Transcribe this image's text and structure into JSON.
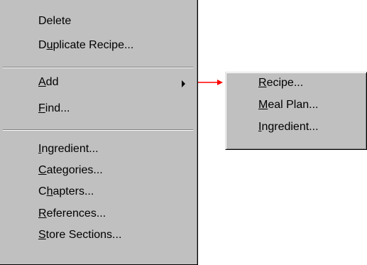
{
  "menu": {
    "items": [
      {
        "pre": "",
        "ul": "",
        "post": "Delete"
      },
      {
        "pre": "D",
        "ul": "u",
        "post": "plicate Recipe..."
      },
      {
        "pre": "",
        "ul": "A",
        "post": "dd"
      },
      {
        "pre": "",
        "ul": "F",
        "post": "ind..."
      },
      {
        "pre": "",
        "ul": "I",
        "post": "ngredient..."
      },
      {
        "pre": "",
        "ul": "C",
        "post": "ategories..."
      },
      {
        "pre": "C",
        "ul": "h",
        "post": "apters..."
      },
      {
        "pre": "",
        "ul": "R",
        "post": "eferences..."
      },
      {
        "pre": "",
        "ul": "S",
        "post": "tore Sections..."
      }
    ]
  },
  "submenu": {
    "items": [
      {
        "pre": "",
        "ul": "R",
        "post": "ecipe..."
      },
      {
        "pre": "",
        "ul": "M",
        "post": "eal Plan..."
      },
      {
        "pre": "",
        "ul": "I",
        "post": "ngredient..."
      }
    ]
  },
  "colors": {
    "menu_bg": "#c0c0c0",
    "title_accent": "#0a1aa8",
    "callout_arrow": "#ff0000"
  },
  "icons": {
    "submenu_indicator": "triangle-right",
    "callout": "red-arrow-right"
  }
}
